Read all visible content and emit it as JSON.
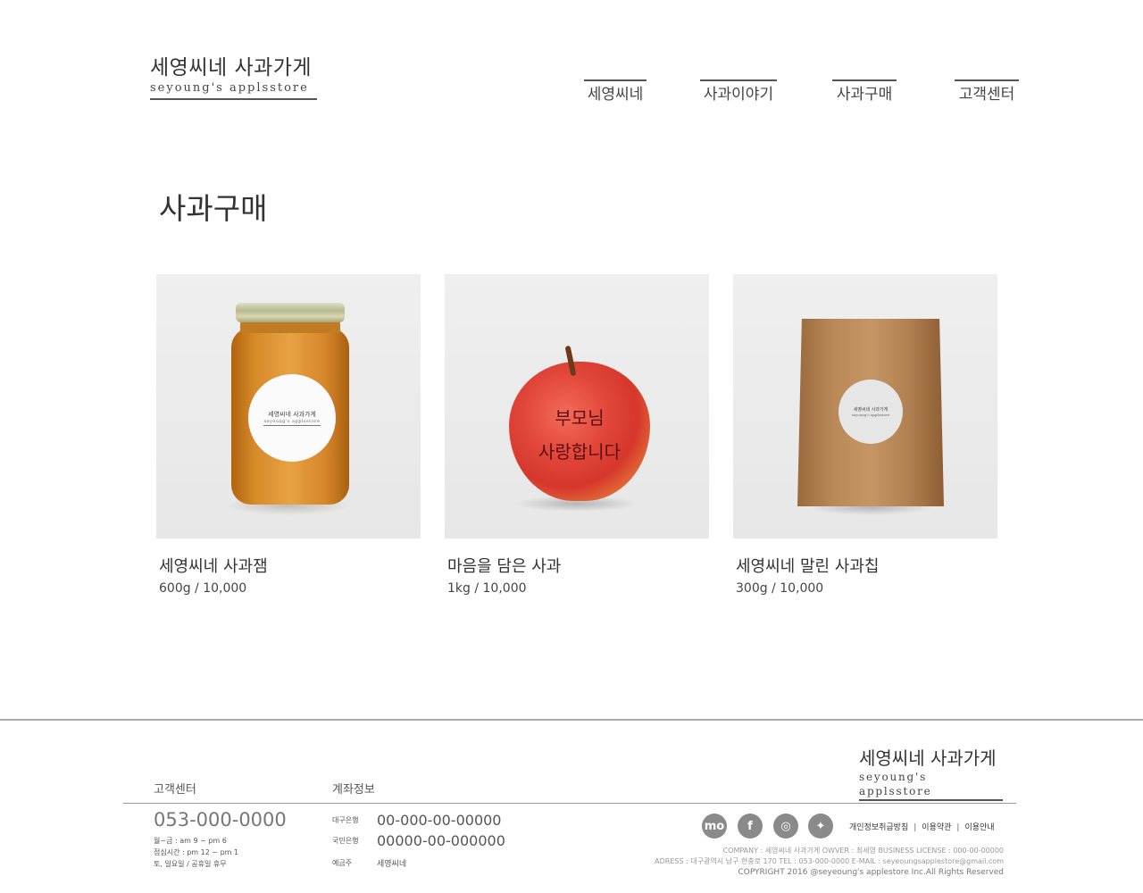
{
  "header": {
    "logo_kr": "세영씨네 사과가게",
    "logo_en": "seyoung's applsstore",
    "nav": [
      {
        "label": "세영씨네"
      },
      {
        "label": "사과이야기"
      },
      {
        "label": "사과구매"
      },
      {
        "label": "고객센터"
      }
    ]
  },
  "main": {
    "page_title": "사과구매",
    "products": [
      {
        "name": "세영씨네 사과잼",
        "price": "600g / 10,000",
        "label_kr": "세영씨네 사과가게",
        "label_en": "seyoung's applsstore"
      },
      {
        "name": "마음을 담은 사과",
        "price": "1kg / 10,000",
        "apple_line1": "부모님",
        "apple_line2": "사랑합니다"
      },
      {
        "name": "세영씨네 말린 사과칩",
        "price": "300g / 10,000",
        "label_kr": "세영씨네 사과가게",
        "label_en": "seyoung's applestore"
      }
    ]
  },
  "footer": {
    "logo_kr": "세영씨네 사과가게",
    "logo_en": "seyoung's applsstore",
    "customer_center": {
      "heading": "고객센터",
      "phone": "053-000-0000",
      "hours": [
        "월~금 : am 9 ~ pm 6",
        "점심시간 : pm 12 ~ pm 1",
        "토, 일요일 / 공휴일 휴무"
      ]
    },
    "account": {
      "heading": "계좌정보",
      "rows": [
        {
          "bank": "대구은행",
          "number": "00-000-00-00000"
        },
        {
          "bank": "국민은행",
          "number": "00000-00-000000"
        }
      ],
      "owner_label": "예금주",
      "owner": "세영씨네"
    },
    "social": [
      {
        "icon": "mo-icon",
        "glyph": "mo"
      },
      {
        "icon": "facebook-icon",
        "glyph": "f"
      },
      {
        "icon": "instagram-icon",
        "glyph": "◎"
      },
      {
        "icon": "twitter-icon",
        "glyph": "✦"
      }
    ],
    "links": [
      "개인정보취급방침",
      "이용약관",
      "이용안내"
    ],
    "info_line1": "COMPANY : 세영씨네 사과가게  OWVER : 최세영  BUSINESS LICENSE : 000-00-00000",
    "info_line2": "ADRESS : 대구광역시 남구 현충로 170  TEL : 053-000-0000  E-MAIL : seyeoungsapplestore@gmail.com",
    "copyright": "COPYRIGHT 2016 @seyeoung's applestore Inc.All Rights Reserved"
  }
}
